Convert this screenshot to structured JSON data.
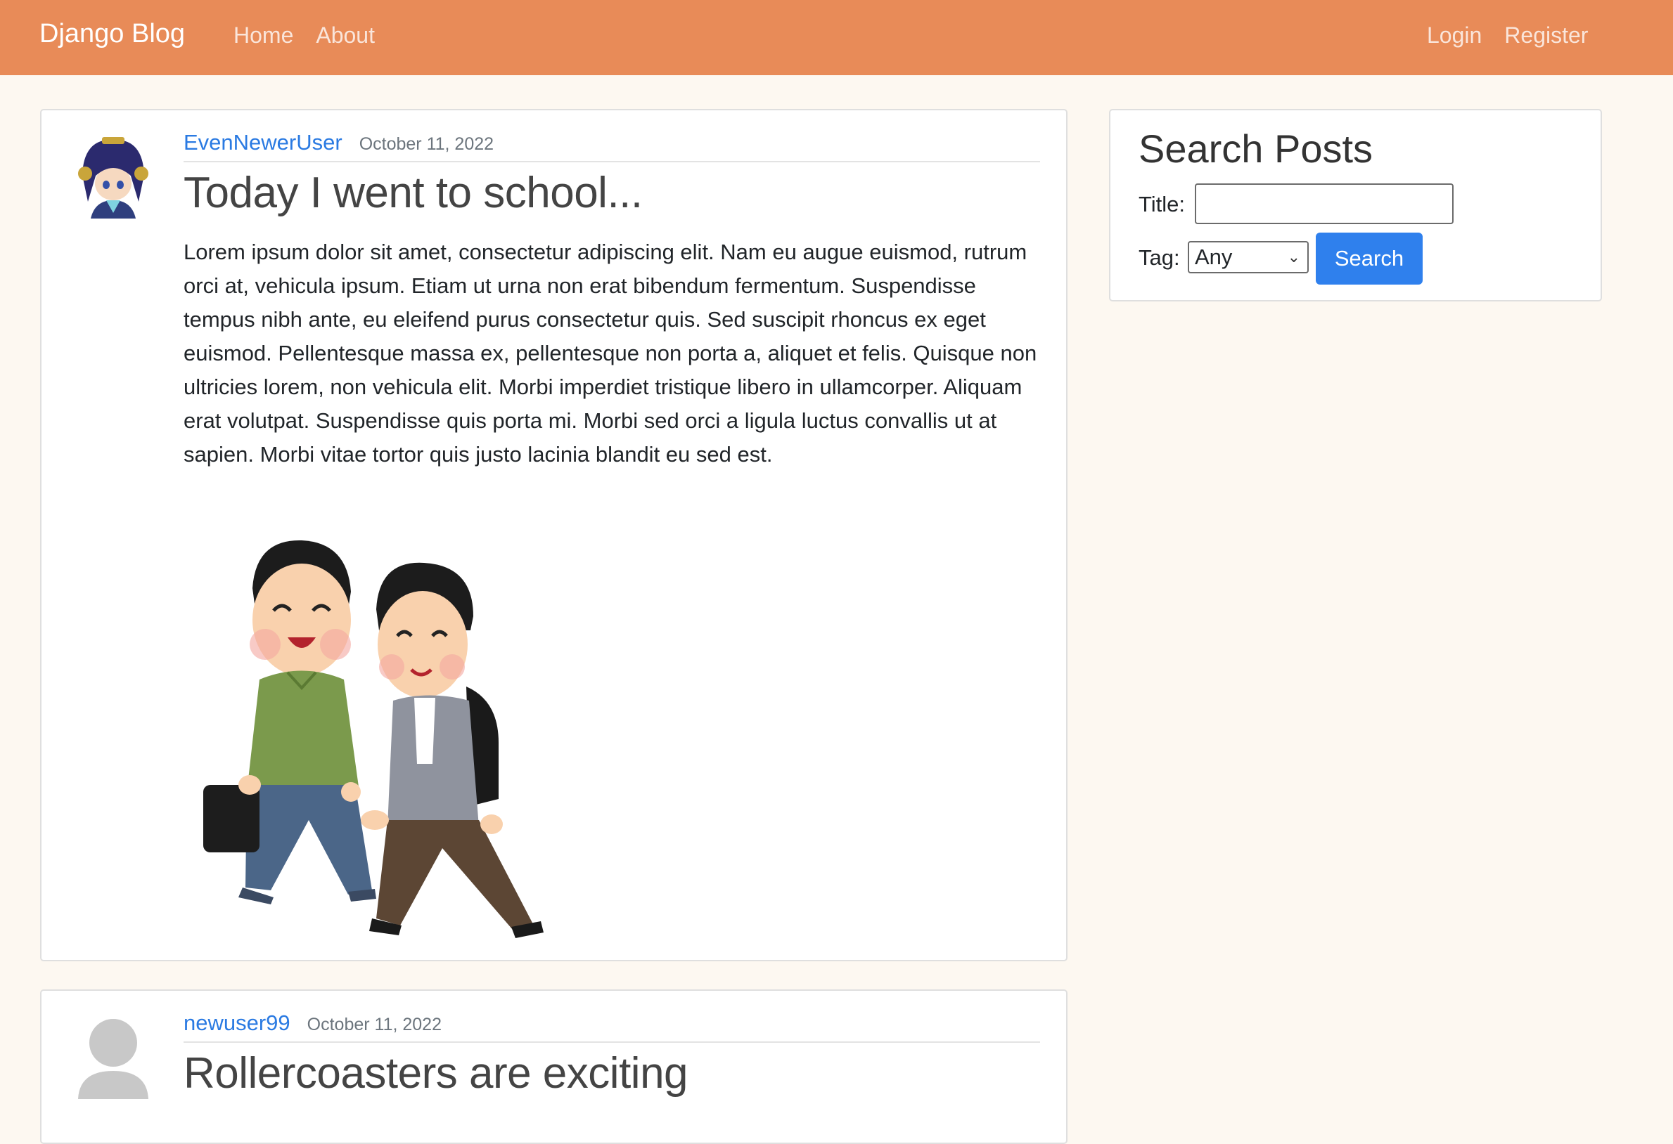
{
  "nav": {
    "brand": "Django Blog",
    "left_links": [
      "Home",
      "About"
    ],
    "right_links": [
      "Login",
      "Register"
    ]
  },
  "posts": [
    {
      "author": "EvenNewerUser",
      "date": "October 11, 2022",
      "title": "Today I went to school...",
      "content": "Lorem ipsum dolor sit amet, consectetur adipiscing elit. Nam eu augue euismod, rutrum orci at, vehicula ipsum. Etiam ut urna non erat bibendum fermentum. Suspendisse tempus nibh ante, eu eleifend purus consectetur quis. Sed suscipit rhoncus ex eget euismod. Pellentesque massa ex, pellentesque non porta a, aliquet et felis. Quisque non ultricies lorem, non vehicula elit. Morbi imperdiet tristique libero in ullamcorper. Aliquam erat volutpat. Suspendisse quis porta mi. Morbi sed orci a ligula luctus convallis ut at sapien. Morbi vitae tortor quis justo lacinia blandit eu sed est."
    },
    {
      "author": "newuser99",
      "date": "October 11, 2022",
      "title": "Rollercoasters are exciting"
    }
  ],
  "sidebar": {
    "title": "Search Posts",
    "title_label": "Title:",
    "title_value": "",
    "tag_label": "Tag:",
    "tag_selected": "Any",
    "search_button": "Search"
  },
  "colors": {
    "navbar": "#e88b58",
    "page_background": "#fdf8f1",
    "link": "#2a7ae2",
    "button": "#2f80ed"
  }
}
